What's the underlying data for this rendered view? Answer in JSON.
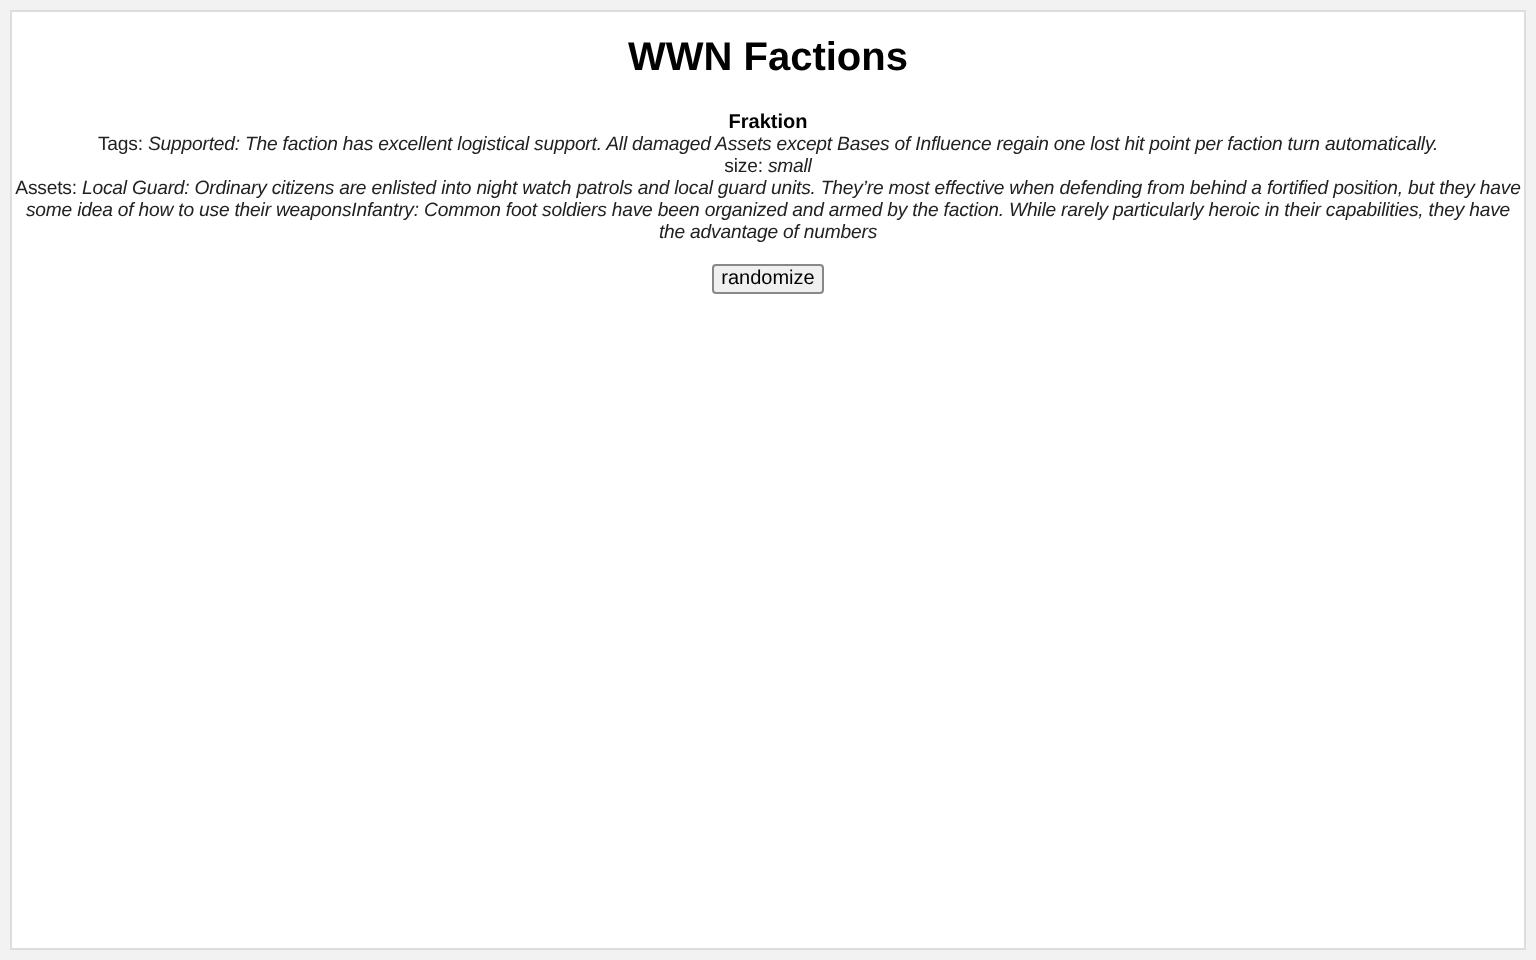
{
  "title": "WWN Factions",
  "faction": {
    "name": "Fraktion",
    "lines": [
      "Tags: *Supported: The faction has excellent logistical support. All damaged Assets except Bases of Influence regain one lost hit point per faction turn automatically.*",
      "size: *small*",
      "Assets: *Local Guard: Ordinary citizens are enlisted into night watch patrols and local guard units. They’re most effective when defending from behind a fortified position, but they have some idea of how to use their weaponsInfantry: Common foot soldiers have been organized and armed by the faction. While rarely particularly heroic in their capabilities, they have the advantage of numbers*"
    ]
  },
  "button": "randomize"
}
